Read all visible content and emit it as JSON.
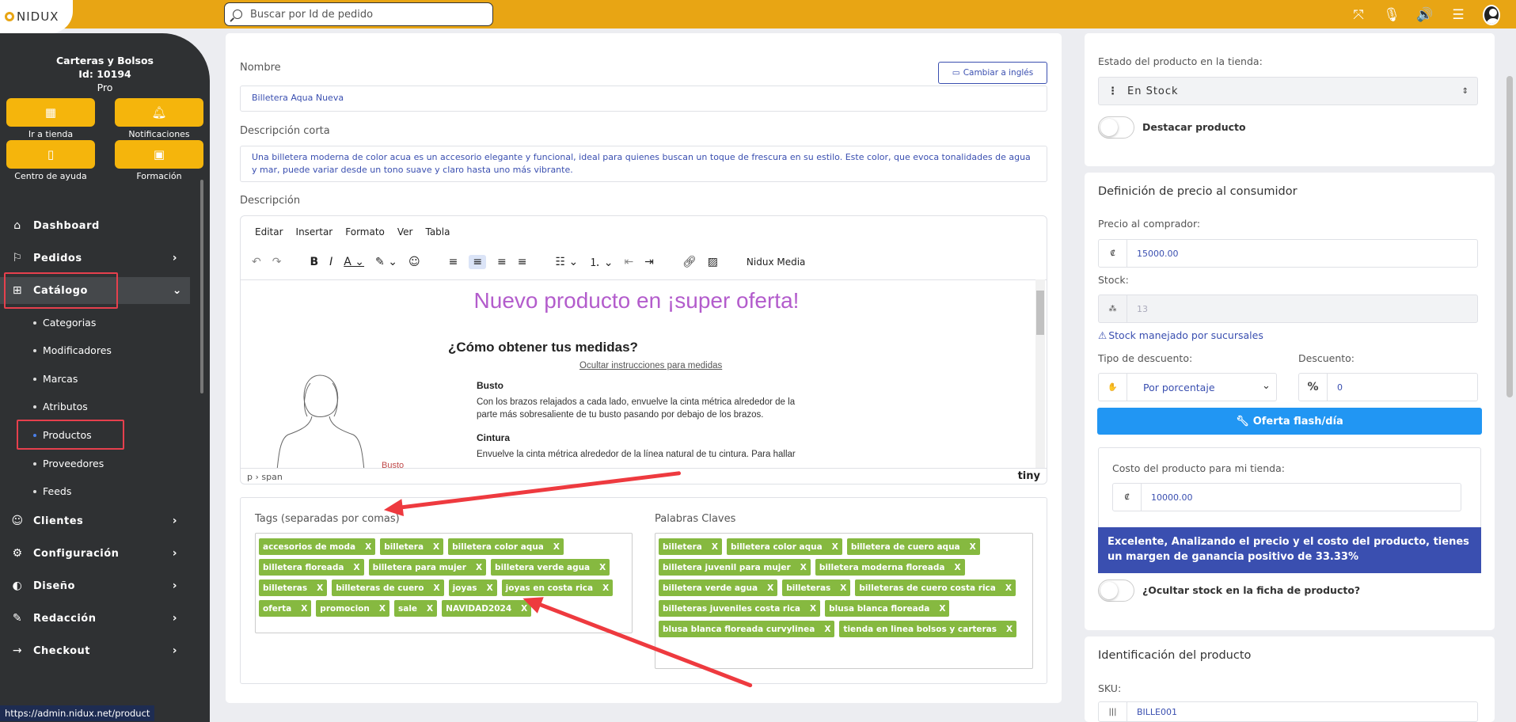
{
  "app": {
    "logo_text": "NIDUX"
  },
  "search": {
    "placeholder": "Buscar por Id de pedido"
  },
  "store": {
    "name": "Carteras y Bolsos",
    "id": "Id: 10194",
    "plan": "Pro"
  },
  "quick_links": [
    {
      "label": "Ir a tienda",
      "icon": "store-icon"
    },
    {
      "label": "Notificaciones",
      "icon": "bell-icon"
    },
    {
      "label": "Centro de ayuda",
      "icon": "book-icon"
    },
    {
      "label": "Formación",
      "icon": "gift-icon"
    }
  ],
  "nav": [
    {
      "label": "Dashboard",
      "icon": "home-icon"
    },
    {
      "label": "Pedidos",
      "icon": "flag-icon"
    },
    {
      "label": "Catálogo",
      "icon": "catalog-icon"
    },
    {
      "label": "Clientes",
      "icon": "users-icon"
    },
    {
      "label": "Configuración",
      "icon": "config-icon"
    },
    {
      "label": "Diseño",
      "icon": "palette-icon"
    },
    {
      "label": "Redacción",
      "icon": "pen-icon"
    },
    {
      "label": "Checkout",
      "icon": "arrow-icon"
    }
  ],
  "catalog_sub": [
    "Categorias",
    "Modificadores",
    "Marcas",
    "Atributos",
    "Productos",
    "Proveedores",
    "Feeds"
  ],
  "status_url": "https://admin.nidux.net/product",
  "form": {
    "name_label": "Nombre",
    "name_value": "Billetera Aqua Nueva",
    "lang_button": "Cambiar a inglés",
    "short_desc_label": "Descripción corta",
    "short_desc_value": "Una billetera moderna de color acua es un accesorio elegante y funcional, ideal para quienes buscan un toque de frescura en su estilo. Este color, que evoca tonalidades de agua y mar, puede variar desde un tono suave y claro hasta uno más vibrante.",
    "desc_label": "Descripción"
  },
  "editor": {
    "menus": [
      "Editar",
      "Insertar",
      "Formato",
      "Ver",
      "Tabla"
    ],
    "media_button": "Nidux Media",
    "heading": "Nuevo producto en ¡super oferta!",
    "subheading": "¿Cómo obtener tus medidas?",
    "hide_link": "Ocultar instrucciones para medidas",
    "sec1": "Busto",
    "para1": "Con los brazos relajados a cada lado, envuelve la cinta métrica alrededor de la parte más sobresaliente de tu busto pasando por debajo de los brazos.",
    "sec2": "Cintura",
    "para2": "Envuelve la cinta métrica alrededor de la línea natural de tu cintura. Para hallar",
    "figure_label": "Busto",
    "path": "p › span",
    "brand": "tiny"
  },
  "tags": {
    "label": "Tags (separadas por comas)",
    "items": [
      "accesorios de moda",
      "billetera",
      "billetera color aqua",
      "billetera floreada",
      "billetera para mujer",
      "billetera verde agua",
      "billeteras",
      "billeteras de cuero",
      "joyas",
      "joyas en costa rica",
      "oferta",
      "promocion",
      "sale",
      "NAVIDAD2024"
    ]
  },
  "keywords": {
    "label": "Palabras Claves",
    "items": [
      "billetera",
      "billetera color aqua",
      "billetera de cuero aqua",
      "billetera juvenil para mujer",
      "billetera moderna floreada",
      "billetera verde agua",
      "billeteras",
      "billeteras de cuero costa rica",
      "billeteras juveniles costa rica",
      "blusa blanca floreada",
      "blusa blanca floreada curvylinea",
      "tienda en linea bolsos y carteras"
    ]
  },
  "right": {
    "status_label": "Estado del producto en la tienda:",
    "status_value": "En Stock",
    "feature_label": "Destacar producto",
    "price_title": "Definición de precio al consumidor",
    "buyer_price_label": "Precio al comprador:",
    "currency": "₡",
    "buyer_price": "15000.00",
    "stock_label": "Stock:",
    "stock_value": "13",
    "stock_link": "Stock manejado por sucursales",
    "discount_type_label": "Tipo de descuento:",
    "discount_type": "Por porcentaje",
    "discount_label": "Descuento:",
    "discount_symbol": "%",
    "discount_value": "0",
    "flash_button": "Oferta flash/día",
    "cost_label": "Costo del producto para mi tienda:",
    "cost_value": "10000.00",
    "margin_text": "Excelente, Analizando el precio y el costo del producto, tienes un margen de ganancia positivo de",
    "margin_value": "33.33%",
    "hide_stock_label": "¿Ocultar stock en la ficha de producto?",
    "id_title": "Identificación del producto",
    "sku_label": "SKU:",
    "sku_value": "BILLE001"
  },
  "colors": {
    "accent": "#e8a514",
    "sidebar": "#2f3133",
    "tag": "#86b940",
    "primary": "#3a4fb0",
    "flash": "#2196f3",
    "highlight": "#e6404d"
  }
}
